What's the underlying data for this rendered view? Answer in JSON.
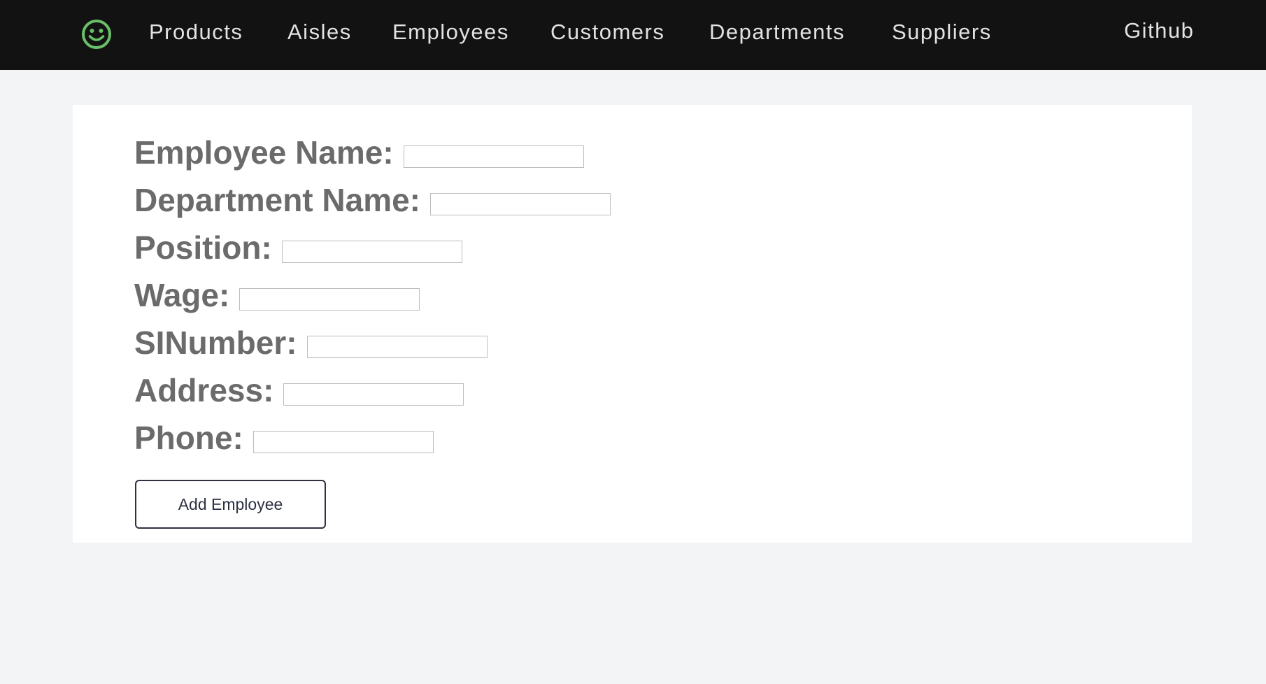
{
  "nav": {
    "logo_icon": "smiley-face-icon",
    "logo_color": "#6abf69",
    "items": [
      "Products",
      "Aisles",
      "Employees",
      "Customers",
      "Departments",
      "Suppliers"
    ],
    "github": "Github"
  },
  "form": {
    "fields": [
      {
        "label": "Employee Name:",
        "value": ""
      },
      {
        "label": "Department Name:",
        "value": ""
      },
      {
        "label": "Position:",
        "value": ""
      },
      {
        "label": "Wage:",
        "value": ""
      },
      {
        "label": "SINumber:",
        "value": ""
      },
      {
        "label": "Address:",
        "value": ""
      },
      {
        "label": "Phone:",
        "value": ""
      }
    ],
    "submit_label": "Add Employee"
  }
}
